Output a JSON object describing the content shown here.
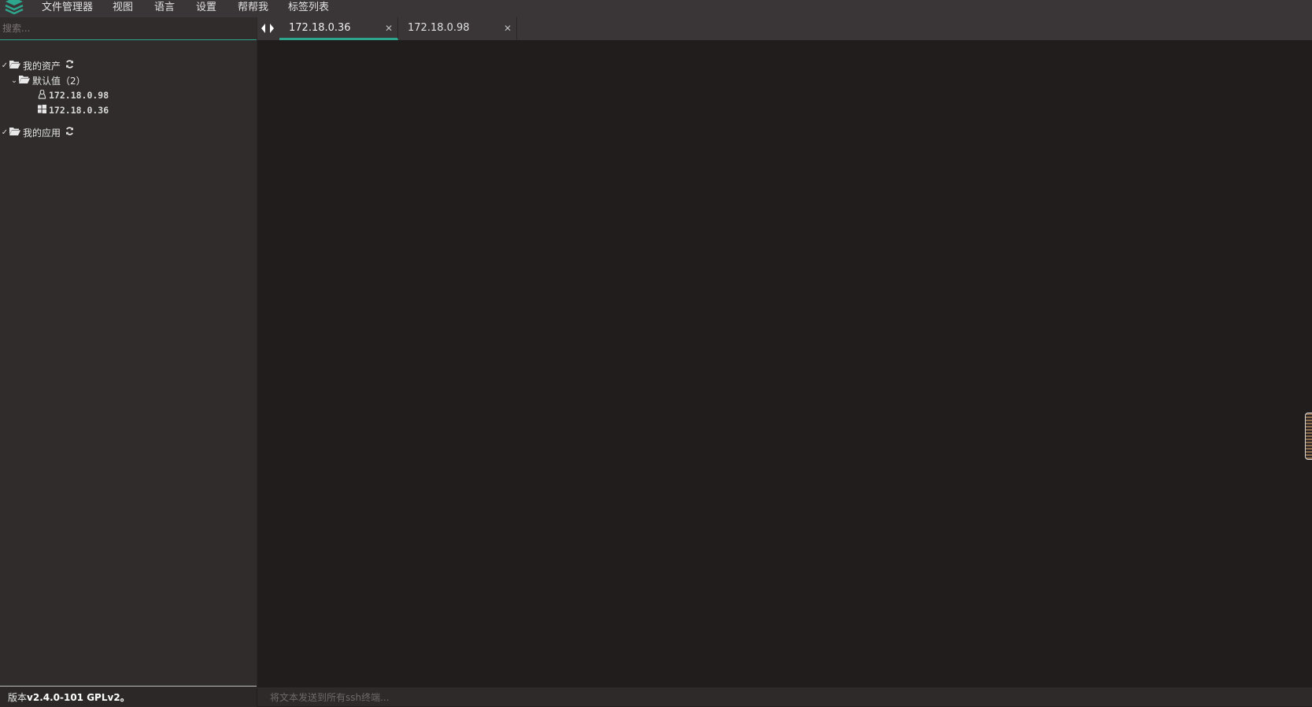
{
  "menubar": {
    "items": [
      "文件管理器",
      "视图",
      "语言",
      "设置",
      "帮帮我",
      "标签列表"
    ]
  },
  "sidebar": {
    "search_placeholder": "搜索...",
    "tree": {
      "assets_label": "我的资产",
      "default_group_label": "默认值（2）",
      "hosts": [
        {
          "label": "172.18.0.98",
          "icon": "linux-icon"
        },
        {
          "label": "172.18.0.36",
          "icon": "windows-icon"
        }
      ],
      "apps_label": "我的应用"
    },
    "footer": {
      "prefix": "版本",
      "version": "v2.4.0-101 GPLv2",
      "suffix": "。"
    }
  },
  "tabs": [
    {
      "label": "172.18.0.36",
      "active": true
    },
    {
      "label": "172.18.0.98",
      "active": false
    }
  ],
  "broadcast": {
    "placeholder": "将文本发送到所有ssh终端..."
  },
  "colors": {
    "accent": "#2ea58d",
    "menubar_bg": "#3a3536",
    "sidebar_bg": "#302c2c",
    "terminal_bg": "#201d1c"
  }
}
